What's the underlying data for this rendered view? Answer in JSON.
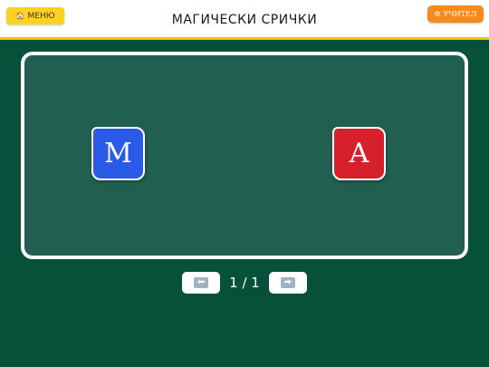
{
  "header": {
    "title": "МАГИЧЕСКИ СРИЧКИ",
    "menu_label": "МЕНЮ",
    "menu_icon": "house-icon",
    "teacher_label": "УЧИТЕЛ",
    "teacher_icon": "gear-icon"
  },
  "board": {
    "tiles": [
      {
        "letter": "М",
        "color": "#2a5be6"
      },
      {
        "letter": "А",
        "color": "#d6212d"
      }
    ]
  },
  "pager": {
    "label": "1 / 1",
    "prev_icon": "arrow-left-icon",
    "next_icon": "arrow-right-icon"
  },
  "colors": {
    "background": "#07503a",
    "board": "#215f51",
    "accent_yellow": "#ffd21f",
    "accent_orange": "#f58a1f"
  }
}
